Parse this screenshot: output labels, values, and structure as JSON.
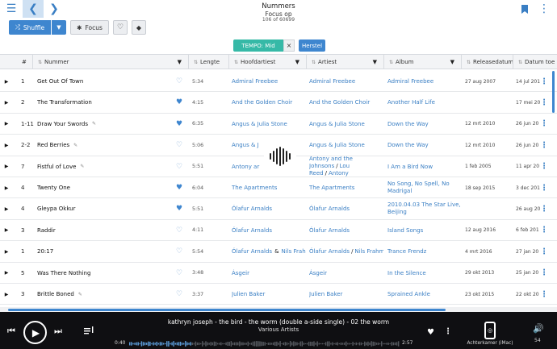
{
  "window": {
    "title": "Nummers",
    "subtitle": "Focus op",
    "count": "106 of 60699"
  },
  "icons": {
    "menu": "hamburger-menu-icon",
    "back": "chevron-left-icon",
    "forward": "chevron-right-icon",
    "bookmark": "bookmark-icon",
    "more": "kebab-menu-icon",
    "shuffle": "shuffle-icon",
    "focus": "focus-icon",
    "heart": "heart-icon",
    "tag": "tag-icon"
  },
  "toolbar": {
    "shuffle_label": "Shuffle",
    "focus_label": "Focus"
  },
  "filter": {
    "chip_label": "TEMPO: Mid",
    "remove_label": "×",
    "reset_label": "Herstel"
  },
  "table": {
    "headers": {
      "num": "#",
      "title": "Nummer",
      "length": "Lengte",
      "main_artist": "Hoofdartiest",
      "artist": "Artiest",
      "album": "Album",
      "release": "Releasedatum",
      "added": "Datum toe"
    },
    "rows": [
      {
        "num": "1",
        "title": "Get Out Of Town",
        "edit": false,
        "liked": false,
        "length": "5:34",
        "main_artist": [
          "Admiral Freebee"
        ],
        "artist": [
          "Admiral Freebee"
        ],
        "album": "Admiral Freebee",
        "release": "27 aug 2007",
        "added": "14 jul 201"
      },
      {
        "num": "2",
        "title": "The Transformation",
        "edit": false,
        "liked": true,
        "length": "4:15",
        "main_artist": [
          "And the Golden Choir"
        ],
        "artist": [
          "And the Golden Choir"
        ],
        "album": "Another Half Life",
        "release": "",
        "added": "17 mei 20"
      },
      {
        "num": "1-11",
        "title": "Draw Your Swords",
        "edit": true,
        "liked": true,
        "length": "6:35",
        "main_artist": [
          "Angus & Julia Stone"
        ],
        "artist": [
          "Angus & Julia Stone"
        ],
        "album": "Down the Way",
        "release": "12 mrt 2010",
        "added": "26 jun 20"
      },
      {
        "num": "2-2",
        "title": "Red Berries",
        "edit": true,
        "liked": false,
        "length": "5:06",
        "main_artist": [
          "Angus & J"
        ],
        "artist": [
          "Angus & Julia Stone"
        ],
        "album": "Down the Way",
        "release": "12 mrt 2010",
        "added": "26 jun 20"
      },
      {
        "num": "7",
        "title": "Fistful of Love",
        "edit": true,
        "liked": false,
        "length": "5:51",
        "main_artist": [
          "Antony ar"
        ],
        "artist": [
          "Antony and the Johnsons",
          "Lou Reed",
          "Antony"
        ],
        "album": "I Am a Bird Now",
        "release": "1 feb 2005",
        "added": "11 apr 20"
      },
      {
        "num": "4",
        "title": "Twenty One",
        "edit": false,
        "liked": true,
        "length": "6:04",
        "main_artist": [
          "The Apartments"
        ],
        "artist": [
          "The Apartments"
        ],
        "album": "No Song, No Spell, No Madrigal",
        "release": "18 sep 2015",
        "added": "3 dec 201"
      },
      {
        "num": "4",
        "title": "Gleypa Okkur",
        "edit": false,
        "liked": true,
        "length": "5:51",
        "main_artist": [
          "Ólafur Arnalds"
        ],
        "artist": [
          "Ólafur Arnalds"
        ],
        "album": "2010.04.03 The Star Live, Beijing",
        "release": "",
        "added": "26 aug 20"
      },
      {
        "num": "3",
        "title": "Raddir",
        "edit": false,
        "liked": false,
        "length": "4:11",
        "main_artist": [
          "Ólafur Arnalds"
        ],
        "artist": [
          "Ólafur Arnalds"
        ],
        "album": "Island Songs",
        "release": "12 aug 2016",
        "added": "6 feb 201"
      },
      {
        "num": "1",
        "title": "20:17",
        "edit": false,
        "liked": false,
        "length": "5:54",
        "main_artist": [
          "Ólafur Arnalds",
          "Nils Frahm"
        ],
        "artist": [
          "Ólafur Arnalds",
          "Nils Frahm"
        ],
        "album": "Trance Frendz",
        "release": "4 mrt 2016",
        "added": "27 jan 20"
      },
      {
        "num": "5",
        "title": "Was There Nothing",
        "edit": false,
        "liked": false,
        "length": "3:48",
        "main_artist": [
          "Ásgeir"
        ],
        "artist": [
          "Ásgeir"
        ],
        "album": "In the Silence",
        "release": "29 okt 2013",
        "added": "25 jan 20"
      },
      {
        "num": "3",
        "title": "Brittle Boned",
        "edit": true,
        "liked": false,
        "length": "3:37",
        "main_artist": [
          "Julien Baker"
        ],
        "artist": [
          "Julien Baker"
        ],
        "album": "Sprained Ankle",
        "release": "23 okt 2015",
        "added": "22 okt 20"
      }
    ]
  },
  "player": {
    "track": "kathryn joseph - the bird - the worm (double a-side single) - 02 the worm",
    "artist": "Various Artists",
    "elapsed": "0:40",
    "total": "2:57",
    "progress": 0.23,
    "device": "Achterkamer (iMac)",
    "volume": "54"
  },
  "colors": {
    "accent": "#3e86cf",
    "link": "#3a7fc4",
    "filter_chip": "#36b9a7",
    "player_bg": "#0f0f12"
  }
}
